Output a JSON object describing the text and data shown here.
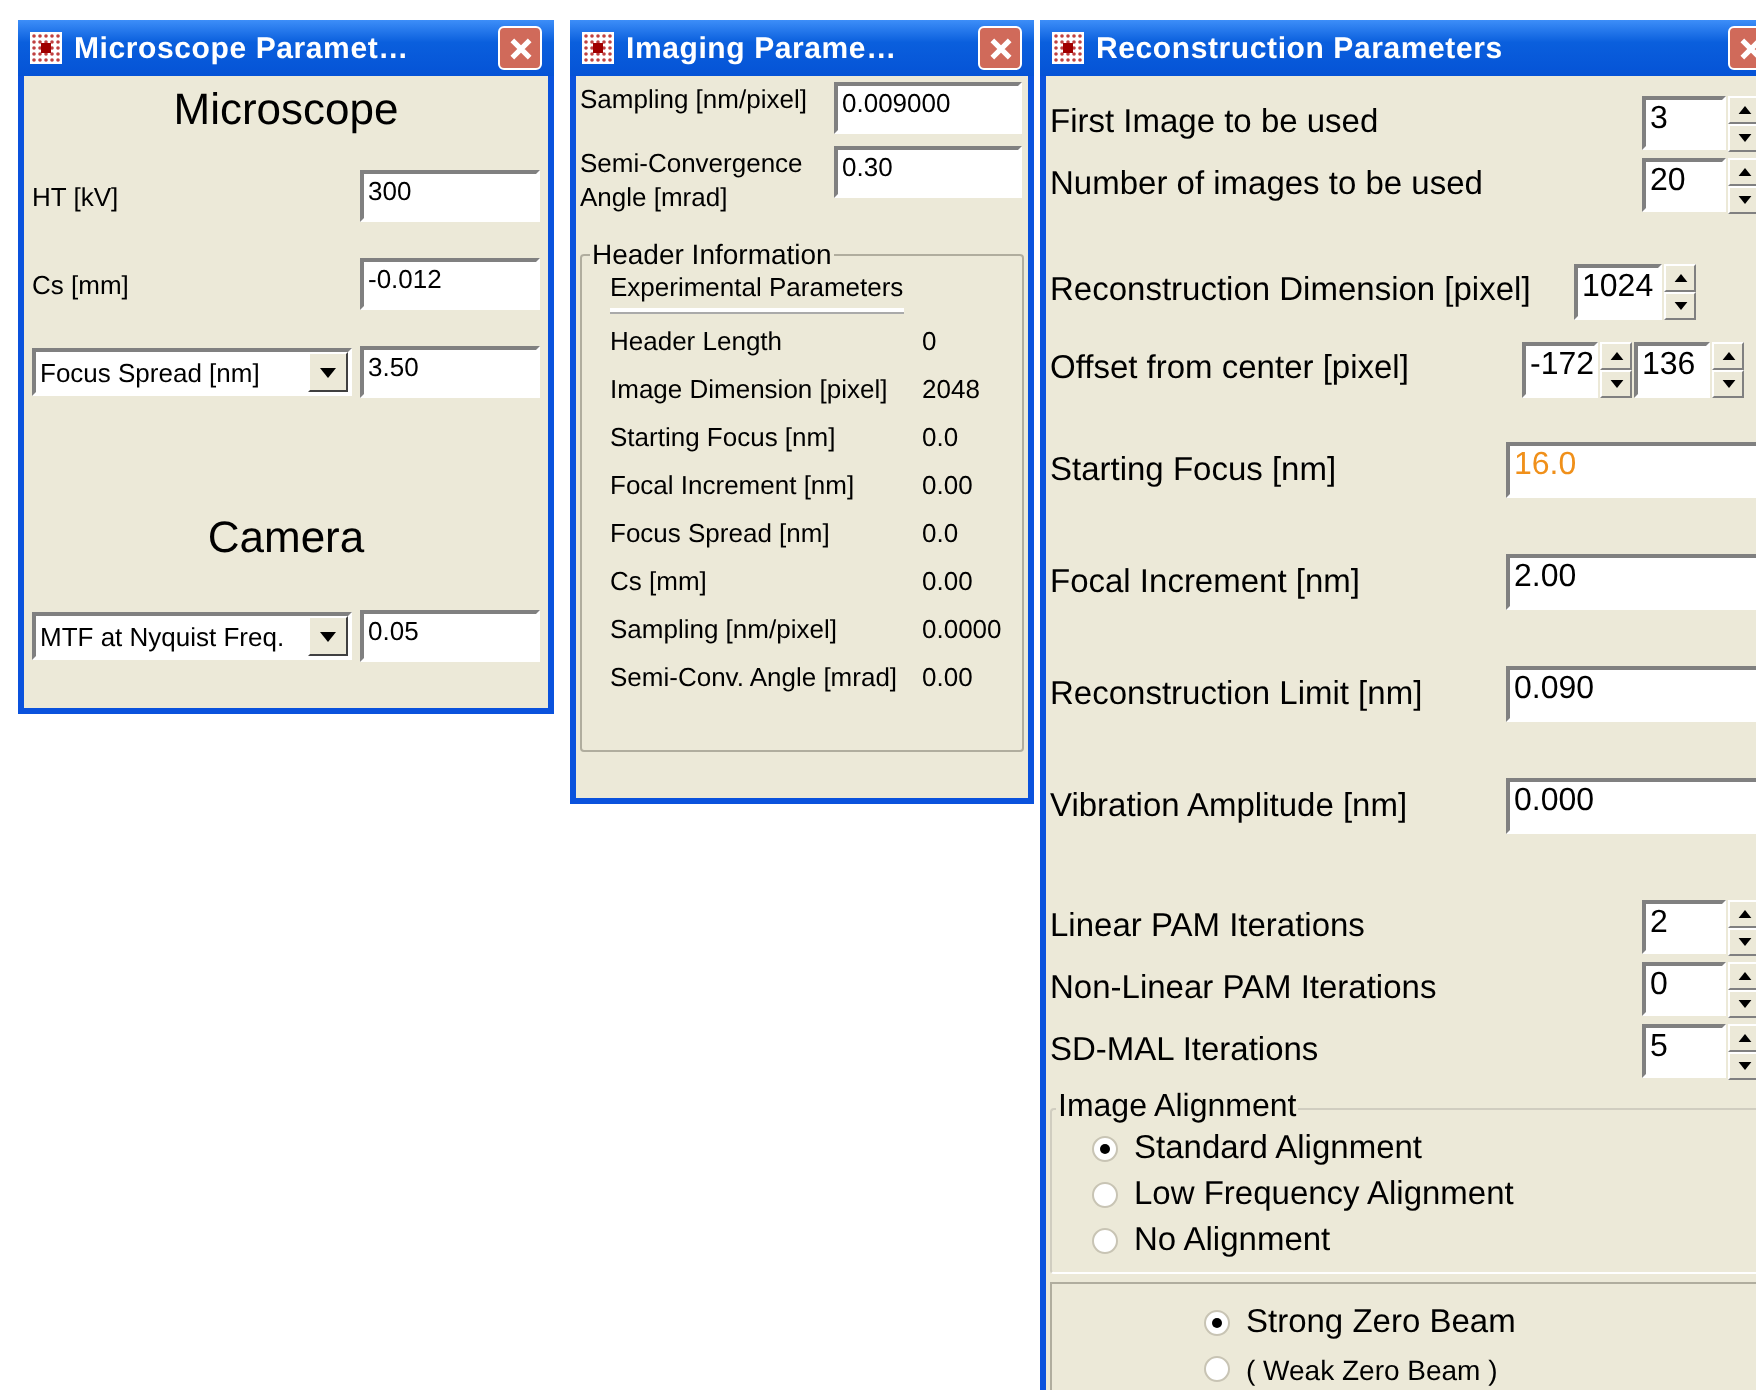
{
  "microscope_window": {
    "title": "Microscope Paramet…",
    "items": [
      {
        "kind": "heading",
        "label": "Microscope"
      },
      {
        "kind": "field",
        "label": "HT [kV]",
        "value": "300"
      },
      {
        "kind": "field",
        "label": "Cs [mm]",
        "value": "-0.012"
      },
      {
        "kind": "dropdown",
        "label": "Focus Spread [nm]",
        "value": "3.50"
      },
      {
        "kind": "heading",
        "label": "Camera"
      },
      {
        "kind": "dropdown",
        "label": "MTF at Nyquist Freq.",
        "value": "0.05"
      }
    ]
  },
  "imaging_window": {
    "title": "Imaging Parame…",
    "fields": [
      {
        "label": "Sampling [nm/pixel]",
        "value": "0.009000"
      },
      {
        "label": "Semi-Convergence Angle [mrad]",
        "value": "0.30"
      }
    ],
    "header_group": {
      "legend": "Header Information",
      "tab": "Experimental Parameters",
      "rows": [
        {
          "label": "Header Length",
          "value": "0"
        },
        {
          "label": "Image Dimension [pixel]",
          "value": "2048"
        },
        {
          "label": "Starting Focus [nm]",
          "value": "0.0"
        },
        {
          "label": "Focal Increment [nm]",
          "value": "0.00"
        },
        {
          "label": "Focus Spread [nm]",
          "value": "0.0"
        },
        {
          "label": "Cs [mm]",
          "value": "0.00"
        },
        {
          "label": "Sampling [nm/pixel]",
          "value": "0.0000"
        },
        {
          "label": "Semi-Conv. Angle [mrad]",
          "value": "0.00"
        }
      ]
    }
  },
  "reconstruction_window": {
    "title": "Reconstruction Parameters",
    "items": [
      {
        "kind": "spinner",
        "label": "First Image to be used",
        "values": [
          "3"
        ]
      },
      {
        "kind": "spinner",
        "label": "Number of images to be used",
        "values": [
          "20"
        ]
      },
      {
        "kind": "dimension",
        "label": "Reconstruction Dimension [pixel]",
        "values": [
          "1024"
        ]
      },
      {
        "kind": "offset",
        "label": "Offset from center [pixel]",
        "values": [
          "-172",
          "136"
        ]
      },
      {
        "kind": "field",
        "label": "Starting Focus [nm]",
        "values": [
          "16.0"
        ],
        "highlighted": true
      },
      {
        "kind": "field",
        "label": "Focal Increment [nm]",
        "values": [
          "2.00"
        ],
        "highlighted": false
      },
      {
        "kind": "field",
        "label": "Reconstruction Limit [nm]",
        "values": [
          "0.090"
        ],
        "highlighted": false
      },
      {
        "kind": "field",
        "label": "Vibration Amplitude [nm]",
        "values": [
          "0.000"
        ],
        "highlighted": false
      },
      {
        "kind": "spinner",
        "label": "Linear PAM Iterations",
        "values": [
          "2"
        ]
      },
      {
        "kind": "spinner",
        "label": "Non-Linear PAM Iterations",
        "values": [
          "0"
        ]
      },
      {
        "kind": "spinner",
        "label": "SD-MAL Iterations",
        "values": [
          "5"
        ]
      }
    ],
    "alignment": {
      "legend": "Image Alignment",
      "options": [
        {
          "label": "Standard Alignment",
          "selected": true
        },
        {
          "label": "Low Frequency Alignment",
          "selected": false
        },
        {
          "label": "No Alignment",
          "selected": false
        }
      ]
    },
    "beam_options": [
      {
        "label": "Strong Zero Beam",
        "selected": true
      },
      {
        "label": "( Weak Zero Beam )",
        "selected": false
      }
    ]
  }
}
